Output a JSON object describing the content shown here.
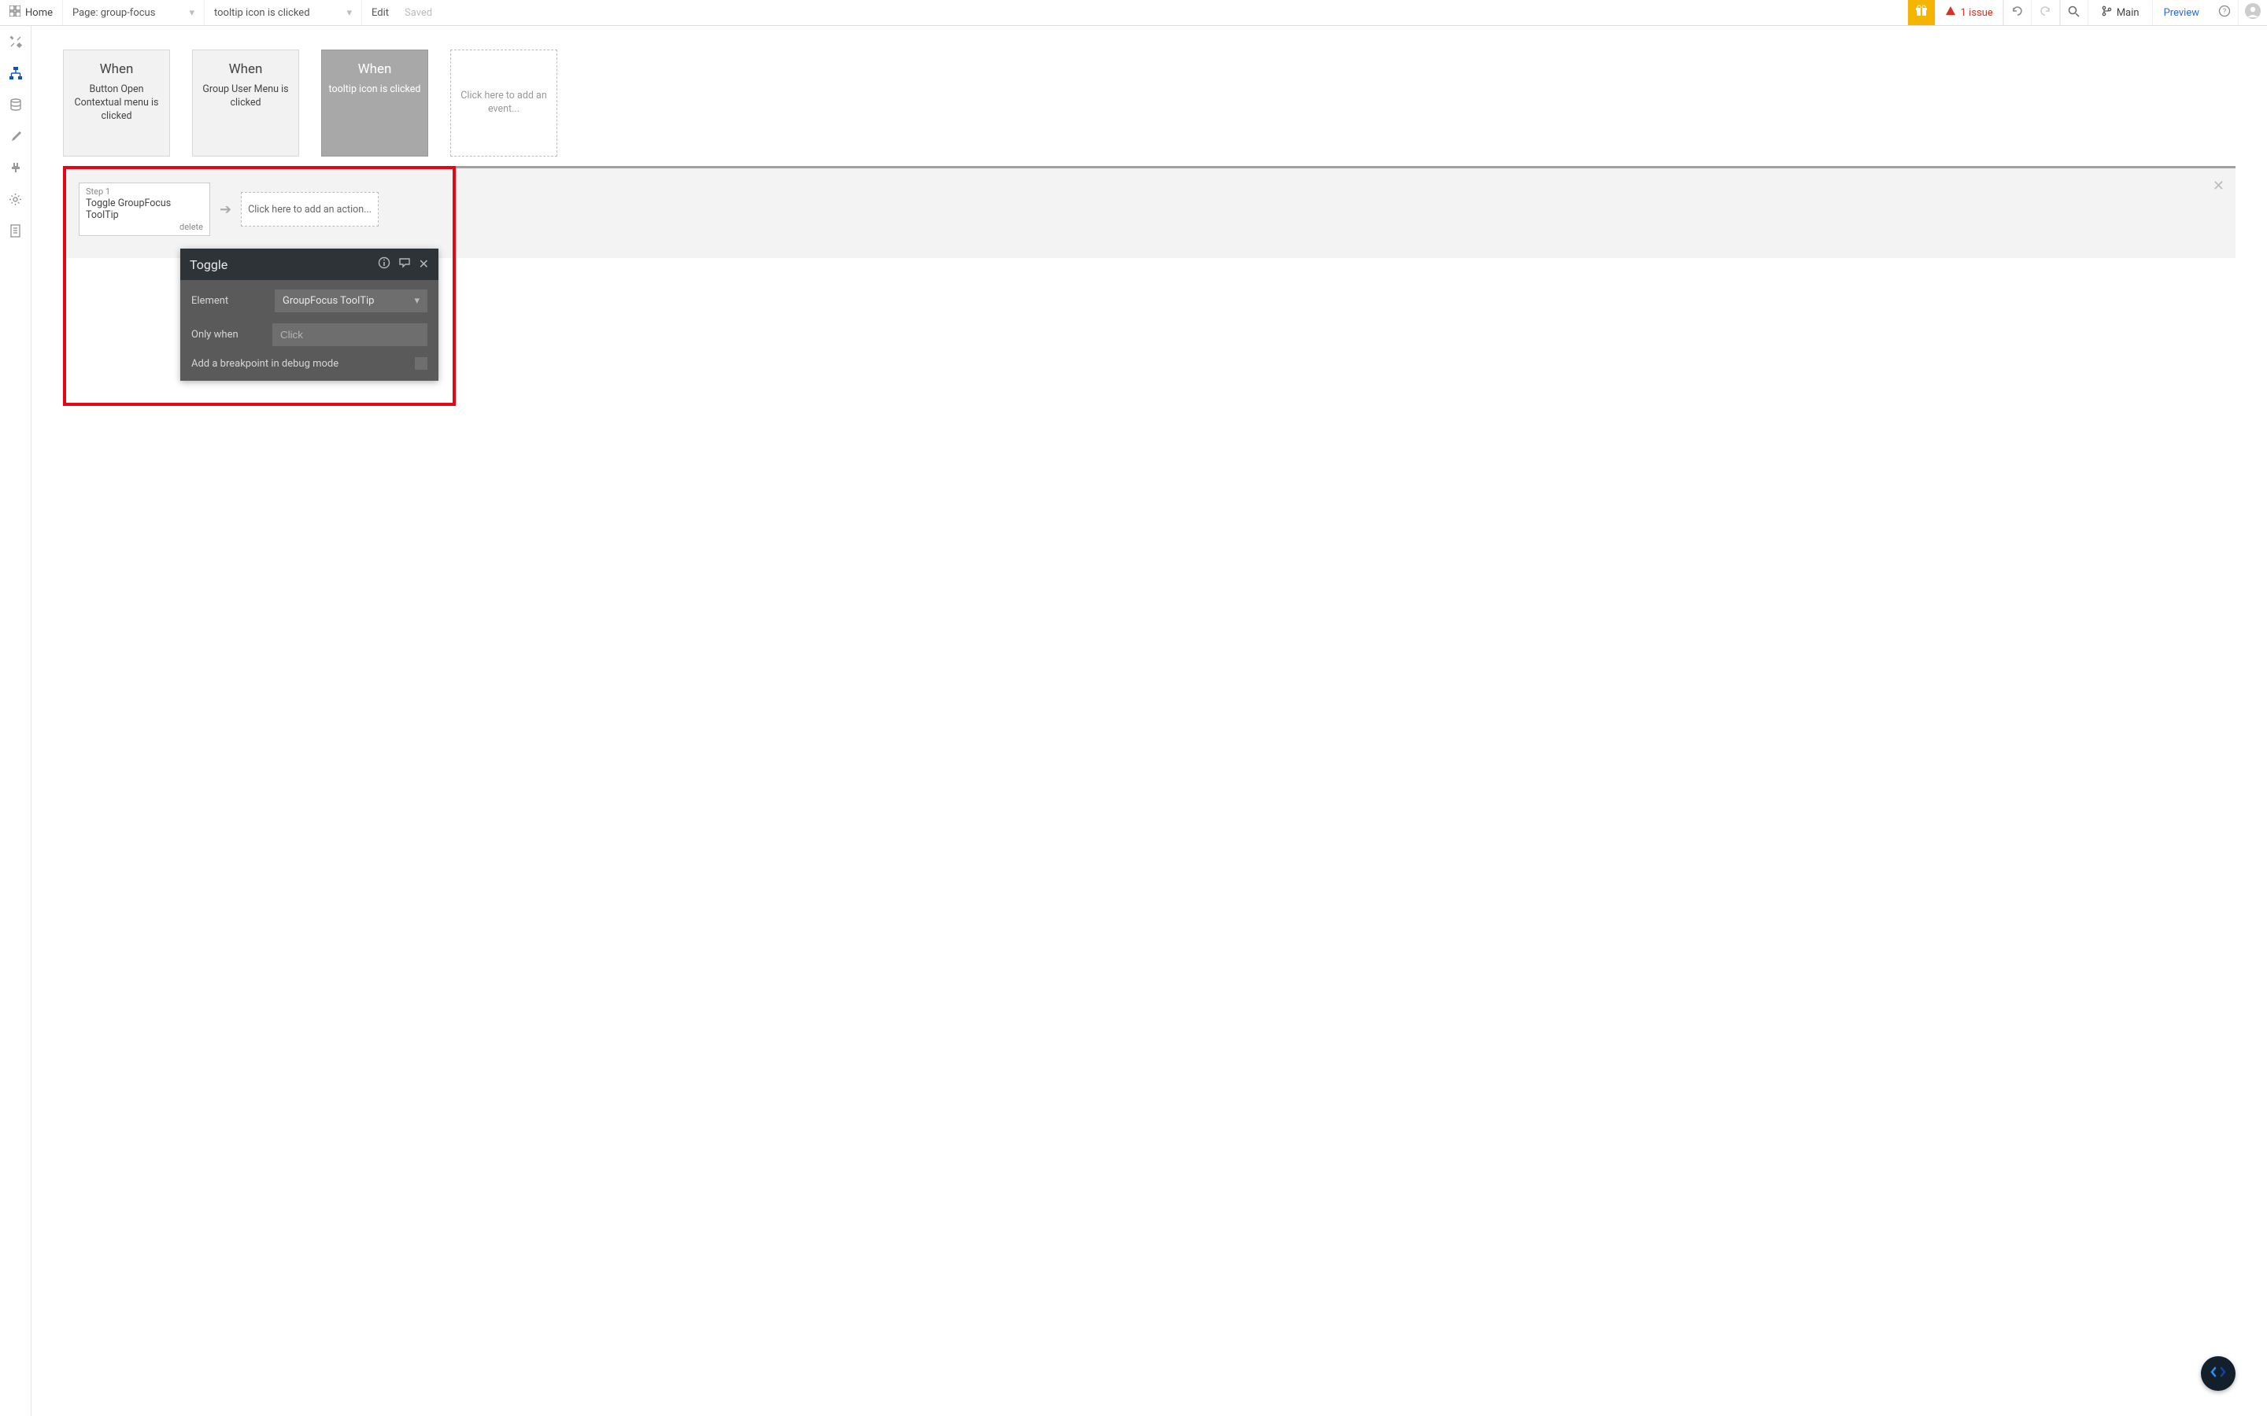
{
  "topbar": {
    "home": "Home",
    "page_label": "Page: group-focus",
    "workflow_select": "tooltip icon is clicked",
    "edit": "Edit",
    "saved": "Saved",
    "issue_text": "1 issue",
    "branch": "Main",
    "preview": "Preview"
  },
  "sidebar": {
    "items": [
      {
        "name": "design",
        "active": false
      },
      {
        "name": "workflow",
        "active": true
      },
      {
        "name": "data",
        "active": false
      },
      {
        "name": "styles",
        "active": false
      },
      {
        "name": "plugins",
        "active": false
      },
      {
        "name": "settings",
        "active": false
      },
      {
        "name": "logs",
        "active": false
      }
    ]
  },
  "events": [
    {
      "when": "When",
      "desc": "Button Open Contextual menu is clicked",
      "selected": false
    },
    {
      "when": "When",
      "desc": "Group User Menu is clicked",
      "selected": false
    },
    {
      "when": "When",
      "desc": "tooltip icon is clicked",
      "selected": true
    }
  ],
  "add_event_text": "Click here to add an event...",
  "workflow": {
    "step_no": "Step 1",
    "step_title": "Toggle GroupFocus ToolTip",
    "step_delete": "delete",
    "add_action": "Click here to add an action..."
  },
  "prop_panel": {
    "title": "Toggle",
    "element_label": "Element",
    "element_value": "GroupFocus ToolTip",
    "only_when_label": "Only when",
    "only_when_placeholder": "Click",
    "breakpoint_label": "Add a breakpoint in debug mode"
  }
}
